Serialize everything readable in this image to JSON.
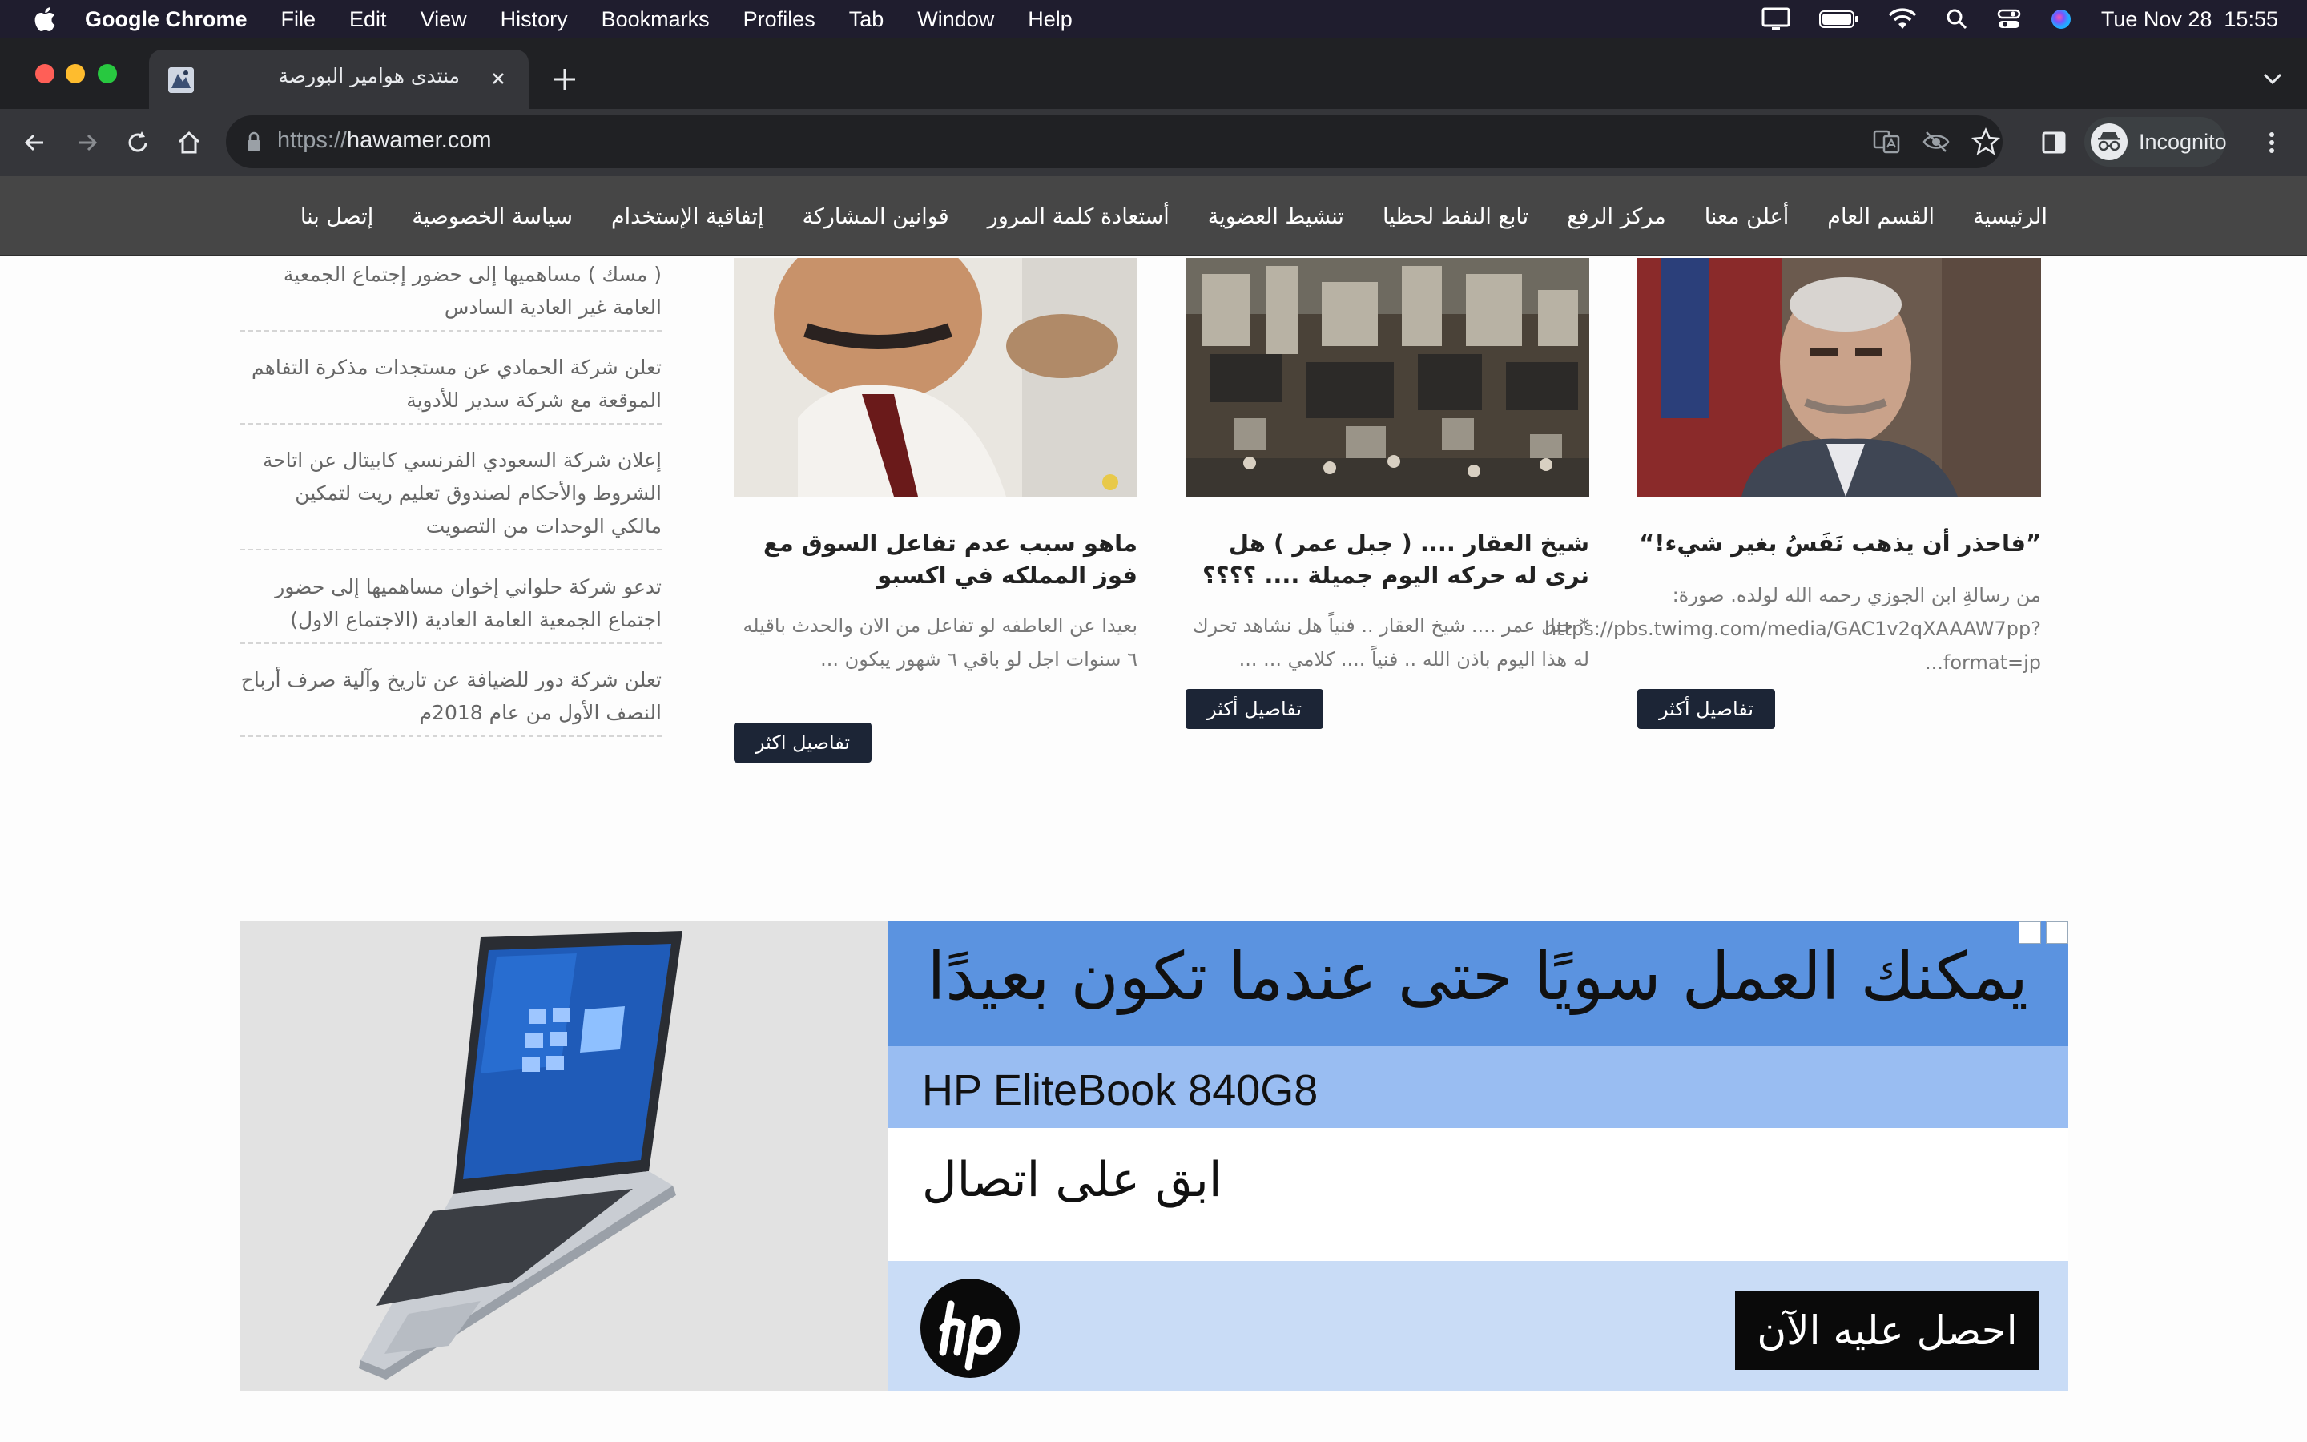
{
  "menubar": {
    "app": "Google Chrome",
    "items": [
      "File",
      "Edit",
      "View",
      "History",
      "Bookmarks",
      "Profiles",
      "Tab",
      "Window",
      "Help"
    ],
    "clock": "Tue Nov 28  15:55"
  },
  "browser": {
    "tab_title": "منتدى هوامير البورصة",
    "url_scheme": "https://",
    "url_host": "hawamer.com",
    "profile_label": "Incognito"
  },
  "site_nav": {
    "items": [
      "الرئيسية",
      "القسم العام",
      "أعلن معنا",
      "مركز الرفع",
      "تابع النفط لحظيا",
      "تنشيط العضوية",
      "أستعادة كلمة المرور",
      "قوانين المشاركة",
      "إتفاقية الإستخدام",
      "سياسة الخصوصية",
      "إتصل بنا"
    ]
  },
  "articles": [
    {
      "title": "”فاحذر أن يذهب نَفَسُ بغير شيء!“",
      "excerpt": "من رسالةِ ابن الجوزي رحمه الله لولده. صورة: https://pbs.twimg.com/media/GAC1v2qXAAAW7pp?format=jp...",
      "button": "تفاصيل أكثر"
    },
    {
      "title": "شيخ العقار .... ( جبل عمر ) هل نرى له حركه اليوم جميلة .... ؟؟؟؟",
      "excerpt": "* جبل عمر .... شيخ العقار .. فنياً هل نشاهد تحرك له هذا اليوم باذن الله .. فنياً .... كلامي ... ...",
      "button": "تفاصيل أكثر"
    },
    {
      "title": "ماهو سبب عدم تفاعل السوق مع فوز المملكه في اكسبو",
      "excerpt": "بعيدا عن العاطفه لو تفاعل من الان والحدث باقيله ٦ سنوات اجل لو باقي ٦ شهور يبكون ...",
      "button": "تفاصيل اكثر"
    }
  ],
  "sidebar": {
    "items": [
      "( مسك ) مساهميها إلى حضور إجتماع الجمعية العامة غير العادية السادس",
      "تعلن شركة الحمادي عن مستجدات مذكرة التفاهم الموقعة مع شركة سدير للأدوية",
      "إعلان شركة السعودي الفرنسي كابيتال عن اتاحة الشروط والأحكام لصندوق تعليم ريت لتمكين مالكي الوحدات من التصويت",
      "تدعو شركة حلواني إخوان مساهميها إلى حضور اجتماع الجمعية العامة العادية (الاجتماع الاول)",
      "تعلن شركة دور للضيافة عن تاريخ وآلية صرف أرباح النصف الأول من عام 2018م"
    ]
  },
  "ad": {
    "headline": "يمكنك  العمل سويًا حتى عندما تكون بعيدًا",
    "model": "HP EliteBook 840G8",
    "tagline": "ابق على اتصال",
    "cta": "احصل عليه الآن",
    "brand_colors": {
      "band_top": "#5b93e0",
      "band_mid": "#99bdf2",
      "band_bottom": "#c9dcf6"
    }
  }
}
